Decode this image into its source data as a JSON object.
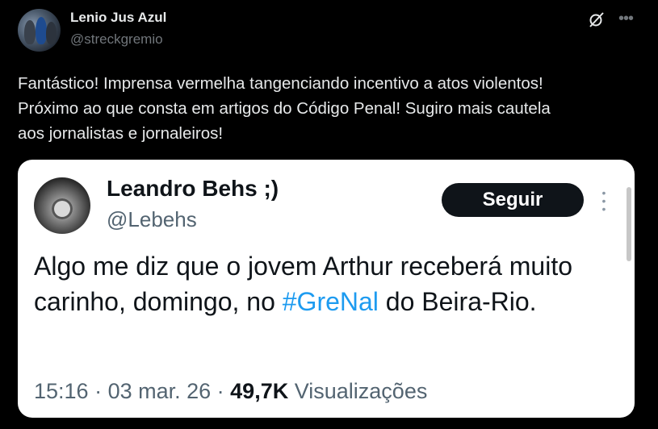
{
  "tweet": {
    "author_name": "Lenio Jus Azul",
    "author_handle": "@streckgremio",
    "text": "Fantástico! Imprensa vermelha tangenciando incentivo a atos violentos!\nPróximo ao que consta em artigos do Código Penal! Sugiro mais cautela\naos jornalistas e jornaleiros!",
    "icons": {
      "grok": "grok-icon",
      "more": "more-icon"
    }
  },
  "embedded": {
    "author_name": "Leandro Behs ;)",
    "author_handle": "@Lebehs",
    "follow_label": "Seguir",
    "text_before": "Algo me diz que o jovem Arthur receberá muito carinho, domingo, no ",
    "hashtag": "#GreNal",
    "text_after": " do Beira-Rio.",
    "time": "15:16",
    "separator": " · ",
    "date": "03 mar. 26",
    "views_count": "49,7K",
    "views_label": "Visualizações"
  },
  "colors": {
    "background": "#000000",
    "text_primary": "#e7e9ea",
    "text_secondary": "#71767b",
    "card_background": "#ffffff",
    "card_text": "#0f1419",
    "card_secondary": "#536471",
    "link": "#1d9bf0"
  }
}
